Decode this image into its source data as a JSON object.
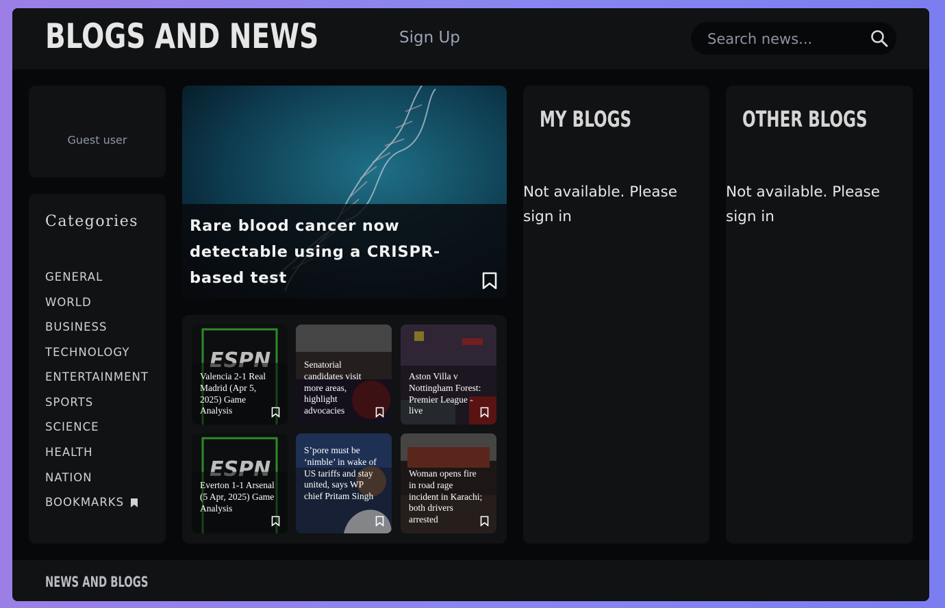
{
  "header": {
    "brand": "BLOGS AND NEWS",
    "signup_label": "Sign Up",
    "search_placeholder": "Search news..."
  },
  "user": {
    "label": "Guest user"
  },
  "categories": {
    "title": "Categories",
    "items": [
      "GENERAL",
      "WORLD",
      "BUSINESS",
      "TECHNOLOGY",
      "ENTERTAINMENT",
      "SPORTS",
      "SCIENCE",
      "HEALTH",
      "NATION",
      "BOOKMARKS"
    ]
  },
  "hero": {
    "title": "Rare blood cancer now detectable using a CRISPR-based test"
  },
  "news": [
    {
      "title": "Valencia 2-1 Real Madrid (Apr 5, 2025) Game Analysis"
    },
    {
      "title": "Senatorial candidates visit more areas, highlight advocacies"
    },
    {
      "title": "Aston Villa v Nottingham Forest: Premier League - live"
    },
    {
      "title": "Everton 1-1 Arsenal (5 Apr, 2025) Game Analysis"
    },
    {
      "title": "S’pore must be ‘nimble’ in wake of US tariffs and stay united, says WP chief Pritam Singh"
    },
    {
      "title": "Woman opens fire in road rage incident in Karachi; both drivers arrested"
    }
  ],
  "my_blogs": {
    "title": "MY BLOGS",
    "message": "Not available. Please sign in"
  },
  "other_blogs": {
    "title": "OTHER BLOGS",
    "message": "Not available. Please sign in"
  },
  "footer": {
    "text": "NEWS AND BLOGS"
  },
  "colors": {
    "background": "#07080a",
    "panel": "#111214",
    "accent_gradient": "#8a86f0"
  },
  "icons": {
    "search": "search-icon",
    "bookmark": "bookmark-icon"
  }
}
